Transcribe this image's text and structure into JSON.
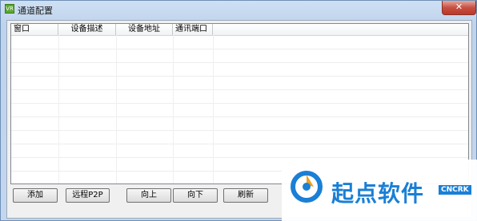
{
  "window": {
    "title": "通道配置",
    "close_symbol": "✕",
    "app_icon_text": "VR"
  },
  "list": {
    "columns": [
      "窗口",
      "设备描述",
      "设备地址",
      "通讯端口"
    ],
    "rows": []
  },
  "buttons": {
    "add": "添加",
    "remote_p2p": "远程P2P",
    "move_up": "向上",
    "move_down": "向下",
    "refresh": "刷新"
  },
  "watermark": {
    "text": "起点软件",
    "badge": "CNCRK"
  },
  "colors": {
    "watermark_blue": "#1a7fd6",
    "close_red": "#c75043"
  }
}
